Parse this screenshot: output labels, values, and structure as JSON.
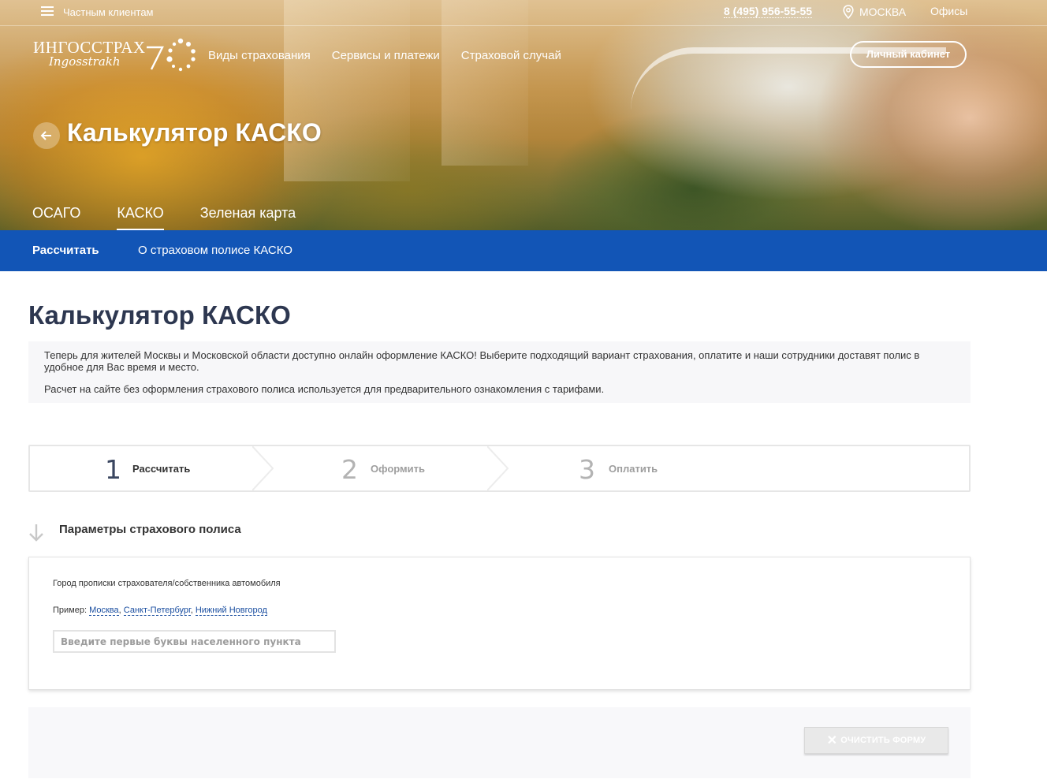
{
  "topbar": {
    "private_clients": "Частным клиентам",
    "phone": "8 (495) 956-55-55",
    "city": "МОСКВА",
    "offices": "Офисы"
  },
  "logo": {
    "line1": "ИНГОССТРАХ",
    "line2": "Ingosstrakh",
    "anniversary": "70"
  },
  "main_nav": [
    "Виды страхования",
    "Сервисы и платежи",
    "Страховой случай"
  ],
  "cabinet_label": "Личный кабинет",
  "hero_title": "Калькулятор КАСКО",
  "product_tabs": [
    {
      "label": "ОСАГО",
      "active": false
    },
    {
      "label": "КАСКО",
      "active": true
    },
    {
      "label": "Зеленая карта",
      "active": false
    }
  ],
  "subnav": [
    "Рассчитать",
    "О страховом полисе КАСКО"
  ],
  "page_title": "Калькулятор КАСКО",
  "info": {
    "p1": "Теперь для жителей Москвы и Московской области доступно онлайн оформление КАСКО! Выберите подходящий вариант страхования, оплатите и наши сотрудники доставят полис в удобное для Вас время и место.",
    "p2": "Расчет на сайте без оформления страхового полиса используется для предварительного ознакомления с тарифами."
  },
  "steps": [
    {
      "num": "1",
      "label": "Рассчитать",
      "active": true
    },
    {
      "num": "2",
      "label": "Оформить",
      "active": false
    },
    {
      "num": "3",
      "label": "Оплатить",
      "active": false
    }
  ],
  "section_title": "Параметры страхового полиса",
  "form": {
    "city_label": "Город прописки страхователя/собственника автомобиля",
    "example_prefix": "Пример:",
    "examples": [
      "Москва",
      "Санкт-Петербург",
      "Нижний Новгород"
    ],
    "city_placeholder": "Введите первые буквы населенного пункта",
    "city_value": ""
  },
  "clear_button": "ОЧИСТИТЬ ФОРМУ",
  "colors": {
    "brand_blue": "#1255b6",
    "title_dark": "#2d3750",
    "link_blue": "#1a4ea0"
  }
}
